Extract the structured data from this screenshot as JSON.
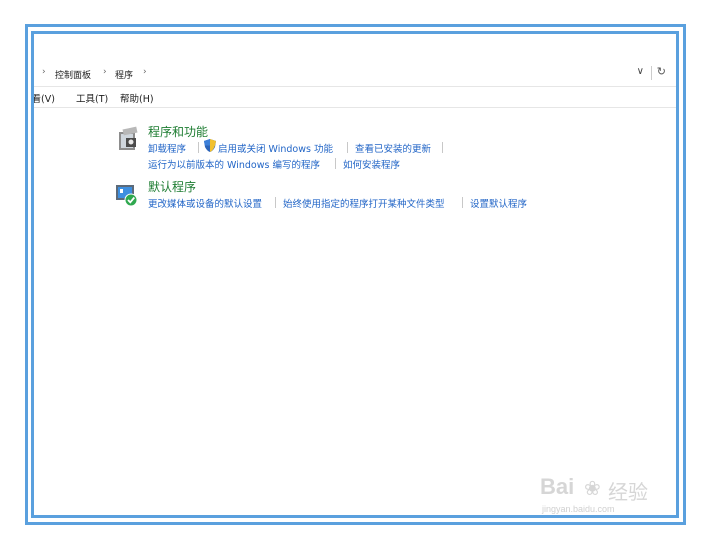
{
  "breadcrumb": {
    "items": [
      "控制面板",
      "程序"
    ]
  },
  "menubar": {
    "view": "查看(V)",
    "tools": "工具(T)",
    "help": "帮助(H)"
  },
  "categories": {
    "programs_features": {
      "title": "程序和功能",
      "links": {
        "uninstall": "卸载程序",
        "toggle_features": "启用或关闭 Windows 功能",
        "view_updates": "查看已安装的更新",
        "compat": "运行为以前版本的 Windows 编写的程序",
        "how_install": "如何安装程序"
      }
    },
    "default_programs": {
      "title": "默认程序",
      "links": {
        "media_defaults": "更改媒体或设备的默认设置",
        "file_types": "始终使用指定的程序打开某种文件类型",
        "set_defaults": "设置默认程序"
      }
    }
  },
  "watermark": {
    "brand": "Bai",
    "brand_cn": "经验",
    "site": "jingyan.baidu.com"
  },
  "colors": {
    "frame": "#5aa0de",
    "title_green": "#1e7d32",
    "link_blue": "#2366c7"
  },
  "icons": [
    "chevron-right-icon",
    "dropdown-arrow-icon",
    "refresh-icon",
    "programs-features-icon",
    "default-programs-icon",
    "shield-icon"
  ]
}
